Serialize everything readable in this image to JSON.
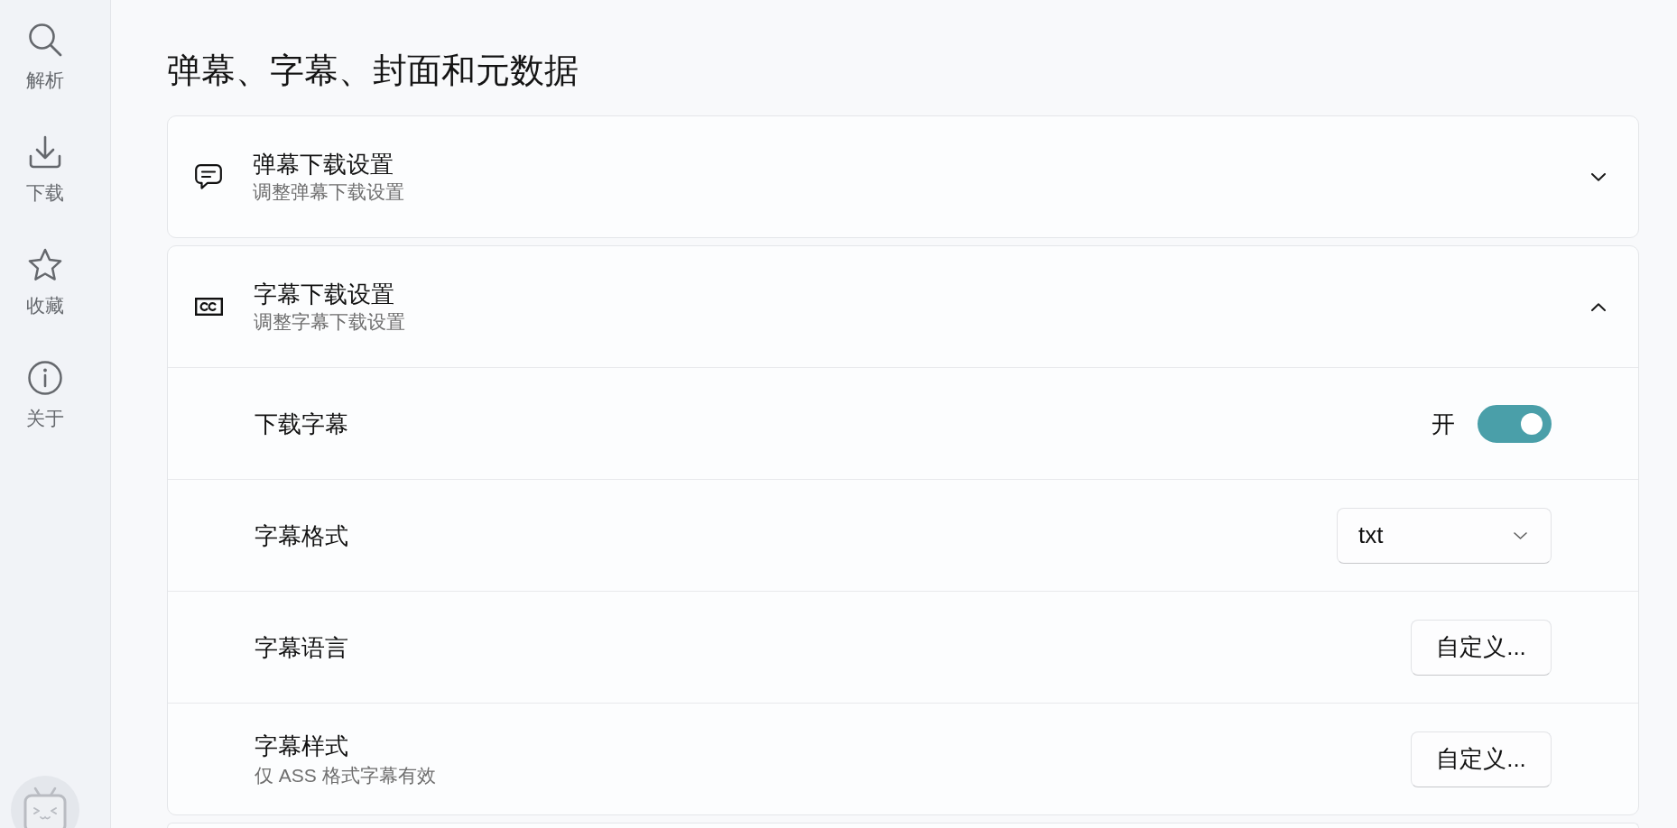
{
  "sidebar": {
    "items": [
      {
        "label": "解析"
      },
      {
        "label": "下载"
      },
      {
        "label": "收藏"
      },
      {
        "label": "关于"
      }
    ]
  },
  "page": {
    "title": "弹幕、字幕、封面和元数据"
  },
  "sections": [
    {
      "title": "弹幕下载设置",
      "subtitle": "调整弹幕下载设置",
      "expanded": false
    },
    {
      "title": "字幕下载设置",
      "subtitle": "调整字幕下载设置",
      "expanded": true,
      "rows": [
        {
          "kind": "toggle",
          "label": "下载字幕",
          "state_label": "开",
          "on": true
        },
        {
          "kind": "select",
          "label": "字幕格式",
          "value": "txt"
        },
        {
          "kind": "button",
          "label": "字幕语言",
          "button_label": "自定义..."
        },
        {
          "kind": "button",
          "label": "字幕样式",
          "description": "仅 ASS 格式字幕有效",
          "button_label": "自定义..."
        }
      ]
    }
  ]
}
